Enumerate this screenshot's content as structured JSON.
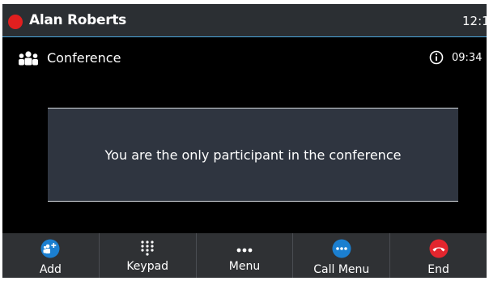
{
  "status_bar": {
    "user_name": "Alan Roberts",
    "clock": "12:1",
    "presence_color": "#e11f1f"
  },
  "conference": {
    "title": "Conference",
    "timer": "09:34",
    "icon": "conference-people-icon",
    "info_icon": "info-icon"
  },
  "message": "You are the only participant in the conference",
  "softkeys": [
    {
      "label": "Add",
      "icon": "add-participant-icon"
    },
    {
      "label": "Keypad",
      "icon": "keypad-icon"
    },
    {
      "label": "Menu",
      "icon": "more-dots-icon"
    },
    {
      "label": "Call Menu",
      "icon": "call-menu-icon"
    },
    {
      "label": "End",
      "icon": "end-call-icon"
    }
  ],
  "colors": {
    "accent_blue": "#1b7fd0",
    "end_red": "#e3262e",
    "status_line": "#4aa7df"
  }
}
